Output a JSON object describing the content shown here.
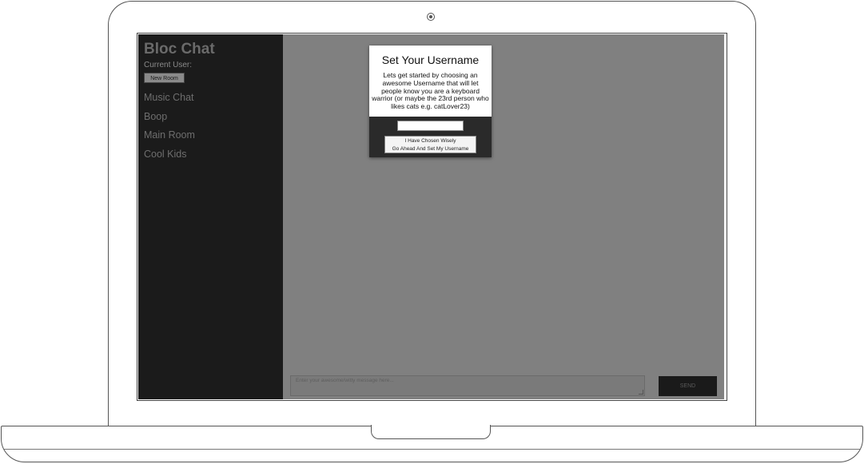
{
  "app": {
    "title": "Bloc Chat",
    "current_user_label": "Current User:",
    "new_room_label": "New Room"
  },
  "rooms": [
    "Music Chat",
    "Boop",
    "Main Room",
    "Cool Kids"
  ],
  "composer": {
    "placeholder": "Enter your awesome/witty message here...",
    "send_label": "SEND"
  },
  "modal": {
    "title": "Set Your Username",
    "text": "Lets get started by choosing an awesome Username that will let people know you are a keyboard warrior (or maybe the 23rd person who likes cats e.g. catLover23)",
    "input_value": "",
    "button_line1": "I Have Chosen Wisely",
    "button_line2": "Go Ahead And Set My Username"
  }
}
